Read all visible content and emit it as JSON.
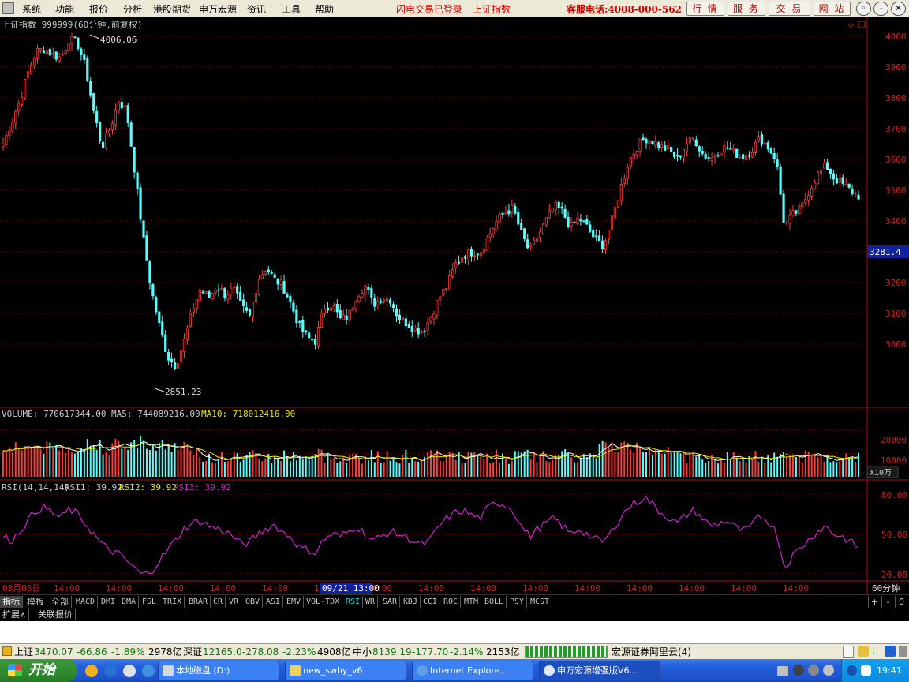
{
  "menu": {
    "items": [
      "系统",
      "功能",
      "报价",
      "分析",
      "港股期货",
      "申万宏源",
      "资讯",
      "工具",
      "帮助"
    ],
    "flash_login": "闪电交易已登录",
    "index_name": "上证指数",
    "hotline": "客服电话:4008-000-562",
    "buttons": [
      "行 情",
      "服 务",
      "交 易",
      "网 站"
    ],
    "win_min": "–",
    "win_restore": "❐",
    "win_close": "✕"
  },
  "price": {
    "title_name": "上证指数 999999(60分钟,前复权)",
    "diamond": "◇",
    "high_label": "4006.06",
    "low_label": "2851.23",
    "current": "3281.4",
    "ticks": [
      "4000",
      "3900",
      "3800",
      "3700",
      "3600",
      "3500",
      "3400",
      "3300",
      "3200",
      "3100",
      "3000"
    ]
  },
  "volume": {
    "title_volume": "VOLUME: 770617344.00",
    "title_ma5": "MA5: 744089216.00",
    "title_ma10": "MA10: 718012416.00",
    "ticks": [
      "20000",
      "10000"
    ],
    "unit": "X10万"
  },
  "rsi": {
    "title_name": "RSI(14,14,14)",
    "title_rsi1": "RSI1: 39.92",
    "title_rsi2": "RSI2: 39.92",
    "title_rsi3": "RSI3: 39.92",
    "ticks": [
      "80.00",
      "50.00",
      "20.00"
    ]
  },
  "time_axis": {
    "labels": [
      "08月05日",
      "14:00",
      "14:00",
      "14:00",
      "14:00",
      "14:00",
      "14:00",
      "14:00",
      "14:00",
      "14:00",
      "14:00",
      "14:00",
      "14:00",
      "14:00",
      "14:00",
      "14:00"
    ],
    "cursor": "09/21 13:00",
    "period": "60分钟"
  },
  "indicator_tabs": [
    "指标",
    "模板",
    "全部",
    "MACD",
    "DMI",
    "DMA",
    "FSL",
    "TRIX",
    "BRAR",
    "CR",
    "VR",
    "OBV",
    "ASI",
    "EMV",
    "VOL-TDX",
    "RSI",
    "WR",
    "SAR",
    "KDJ",
    "CCI",
    "ROC",
    "MTM",
    "BOLL",
    "PSY",
    "MCST"
  ],
  "tab_right": [
    "+",
    "-",
    "0"
  ],
  "sub_tabs": [
    "扩展∧",
    "关联报价"
  ],
  "statusbar": {
    "sh_label": "上证",
    "sh_value": "3470.07",
    "sh_change": "-66.86",
    "sh_pct": "-1.89%",
    "sh_amount": "2978亿",
    "sz_label": "深证",
    "sz_value": "12165.0",
    "sz_change": "-278.08",
    "sz_pct": "-2.23%",
    "sz_amount": "4908亿",
    "zx_label": "中小",
    "zx_value": "8139.19",
    "zx_change": "-177.70",
    "zx_pct": "-2.14%",
    "zx_amount": "2153亿",
    "server": "宏源证券阿里云(4)"
  },
  "taskbar": {
    "start": "开始",
    "tasks": [
      "本地磁盘 (D:)",
      "new_swhy_v6",
      "Internet Explore...",
      "申万宏源增强版V6..."
    ],
    "clock": "19:41"
  },
  "chart_data": [
    {
      "type": "candlestick",
      "title": "上证指数 999999(60分钟,前复权)",
      "ylim": [
        2800,
        4050
      ],
      "annotations": {
        "high": 4006.06,
        "low": 2851.23,
        "current": 3281.4
      },
      "close_path": [
        3650,
        3720,
        3790,
        3880,
        3950,
        3960,
        3940,
        3930,
        3990,
        3980,
        3900,
        3760,
        3640,
        3700,
        3790,
        3760,
        3560,
        3350,
        3180,
        3060,
        2960,
        2930,
        3010,
        3110,
        3180,
        3150,
        3190,
        3160,
        3180,
        3120,
        3090,
        3210,
        3250,
        3210,
        3190,
        3130,
        3060,
        3020,
        3010,
        3120,
        3130,
        3080,
        3090,
        3160,
        3190,
        3130,
        3150,
        3150,
        3090,
        3070,
        3050,
        3040,
        3090,
        3150,
        3190,
        3260,
        3290,
        3300,
        3300,
        3350,
        3400,
        3430,
        3440,
        3360,
        3300,
        3350,
        3400,
        3450,
        3430,
        3380,
        3410,
        3380,
        3340,
        3320,
        3400,
        3500,
        3590,
        3640,
        3670,
        3660,
        3640,
        3630,
        3600,
        3650,
        3670,
        3620,
        3600,
        3630,
        3640,
        3620,
        3610,
        3630,
        3670,
        3640,
        3600,
        3380,
        3420,
        3440,
        3500,
        3550,
        3580,
        3540,
        3520,
        3500,
        3480
      ]
    },
    {
      "type": "bar",
      "title": "VOLUME",
      "ylim": [
        0,
        25000
      ],
      "unit": "X10万",
      "series": [
        {
          "name": "MA5",
          "value": 744089216.0
        },
        {
          "name": "MA10",
          "value": 718012416.0
        }
      ]
    },
    {
      "type": "line",
      "title": "RSI(14,14,14)",
      "ylim": [
        15,
        85
      ],
      "series": [
        {
          "name": "RSI1",
          "values": [
            48,
            45,
            52,
            60,
            68,
            70,
            66,
            62,
            69,
            65,
            58,
            50,
            42,
            38,
            35,
            30,
            24,
            19,
            22,
            30,
            38,
            46,
            54,
            58,
            60,
            56,
            54,
            52,
            48,
            42,
            44,
            50,
            54,
            57,
            51,
            48,
            40,
            38,
            36,
            46,
            50,
            48,
            52,
            56,
            50,
            45,
            48,
            52,
            50,
            48,
            44,
            42,
            46,
            56,
            62,
            66,
            68,
            64,
            62,
            70,
            74,
            72,
            68,
            56,
            48,
            54,
            58,
            62,
            56,
            50,
            54,
            50,
            46,
            44,
            52,
            62,
            70,
            74,
            78,
            72,
            66,
            62,
            58,
            64,
            68,
            62,
            56,
            58,
            60,
            55,
            52,
            56,
            64,
            60,
            52,
            24,
            34,
            40,
            46,
            52,
            56,
            50,
            48,
            44,
            40
          ]
        },
        {
          "name": "RSI2",
          "values": []
        },
        {
          "name": "RSI3",
          "values": []
        }
      ]
    }
  ]
}
